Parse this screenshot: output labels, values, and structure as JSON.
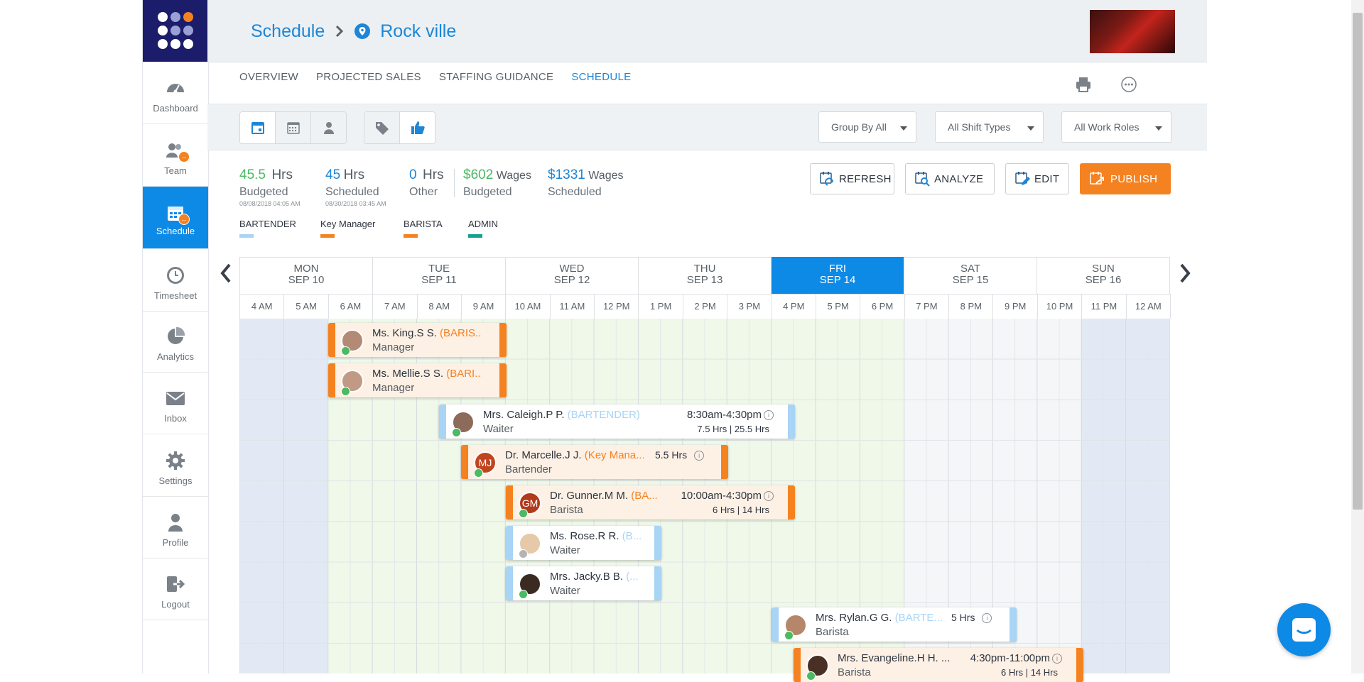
{
  "colors": {
    "brand": "#0d89e6",
    "nav_dark": "#1b1d6a",
    "orange": "#f58220",
    "green": "#4cb963",
    "bartender": "#a8d4f5",
    "admin": "#17a08f"
  },
  "sidebar": {
    "items": [
      {
        "label": "Dashboard",
        "icon": "dashboard-icon"
      },
      {
        "label": "Team",
        "icon": "team-icon",
        "badge": "..."
      },
      {
        "label": "Schedule",
        "icon": "calendar-icon",
        "badge": "...",
        "active": true
      },
      {
        "label": "Timesheet",
        "icon": "clock-icon"
      },
      {
        "label": "Analytics",
        "icon": "pie-chart-icon"
      },
      {
        "label": "Inbox",
        "icon": "mail-icon"
      },
      {
        "label": "Settings",
        "icon": "gear-icon"
      },
      {
        "label": "Profile",
        "icon": "user-icon"
      },
      {
        "label": "Logout",
        "icon": "logout-icon"
      }
    ]
  },
  "header": {
    "crumb_root": "Schedule",
    "crumb_location": "Rock ville"
  },
  "tabs": [
    {
      "label": "OVERVIEW"
    },
    {
      "label": "PROJECTED SALES"
    },
    {
      "label": "STAFFING GUIDANCE"
    },
    {
      "label": "SCHEDULE",
      "active": true
    }
  ],
  "filters": {
    "group": "Group By All",
    "shift_types": "All Shift Types",
    "work_roles": "All Work Roles"
  },
  "stats": {
    "budgeted_hrs": "45.5",
    "budgeted_unit": "Hrs",
    "budgeted_label": "Budgeted",
    "budgeted_ts": "08/08/2018 04:05 AM",
    "scheduled_hrs": "45",
    "scheduled_unit": "Hrs",
    "scheduled_label": "Scheduled",
    "scheduled_ts": "08/30/2018 03:45 AM",
    "other_hrs": "0",
    "other_unit": "Hrs",
    "other_label": "Other",
    "wages_budgeted": "$602",
    "wages_budgeted_unit": "Wages",
    "wages_budgeted_label": "Budgeted",
    "wages_scheduled": "$1331",
    "wages_scheduled_unit": "Wages",
    "wages_scheduled_label": "Scheduled"
  },
  "actions": {
    "refresh": "REFRESH",
    "analyze": "ANALYZE",
    "edit": "EDIT",
    "publish": "PUBLISH"
  },
  "legend": [
    {
      "label": "BARTENDER",
      "color": "#a8d4f5"
    },
    {
      "label": "Key Manager",
      "color": "#f58220"
    },
    {
      "label": "BARISTA",
      "color": "#f58220"
    },
    {
      "label": "ADMIN",
      "color": "#17a08f"
    }
  ],
  "days": [
    {
      "dow": "MON",
      "date": "SEP 10"
    },
    {
      "dow": "TUE",
      "date": "SEP 11"
    },
    {
      "dow": "WED",
      "date": "SEP 12"
    },
    {
      "dow": "THU",
      "date": "SEP 13"
    },
    {
      "dow": "FRI",
      "date": "SEP 14",
      "active": true
    },
    {
      "dow": "SAT",
      "date": "SEP 15"
    },
    {
      "dow": "SUN",
      "date": "SEP 16"
    }
  ],
  "hours": [
    "4 AM",
    "5 AM",
    "6 AM",
    "7 AM",
    "8 AM",
    "9 AM",
    "10 AM",
    "11 AM",
    "12 PM",
    "1 PM",
    "2 PM",
    "3 PM",
    "4 PM",
    "5 PM",
    "6 PM",
    "7 PM",
    "8 PM",
    "9 PM",
    "10 PM",
    "11 PM",
    "12 AM"
  ],
  "shifts": [
    {
      "name": "Ms. King.S S.",
      "role_tag": "(BARIS...",
      "role": "Manager",
      "type": "orange",
      "avatar": "photo",
      "status": "green"
    },
    {
      "name": "Ms. Mellie.S S.",
      "role_tag": "(BARI...",
      "role": "Manager",
      "type": "orange",
      "avatar": "photo",
      "status": "green"
    },
    {
      "name": "Mrs. Caleigh.P P.",
      "role_tag": "(BARTENDER)",
      "role": "Waiter",
      "time": "8:30am-4:30pm",
      "hrs": "7.5 Hrs | 25.5 Hrs",
      "type": "blue",
      "avatar": "photo",
      "status": "green"
    },
    {
      "name": "Dr. Marcelle.J J.",
      "role_tag": "(Key Mana...",
      "role": "Bartender",
      "time": "5.5 Hrs",
      "type": "orange",
      "avatar": "MJ",
      "status": "green"
    },
    {
      "name": "Dr. Gunner.M M.",
      "role_tag": "(BA...",
      "role": "Barista",
      "time": "10:00am-4:30pm",
      "hrs": "6 Hrs | 14 Hrs",
      "type": "orange",
      "avatar": "GM",
      "status": "green"
    },
    {
      "name": "Ms. Rose.R R.",
      "role_tag": "(B...",
      "role": "Waiter",
      "type": "blue",
      "avatar": "photo",
      "status": "gray"
    },
    {
      "name": "Mrs. Jacky.B B.",
      "role_tag": "(...",
      "role": "Waiter",
      "type": "blue",
      "avatar": "photo",
      "status": "green"
    },
    {
      "name": "Mrs. Rylan.G G.",
      "role_tag": "(BARTE...",
      "role": "Barista",
      "time": "5 Hrs",
      "type": "blue",
      "avatar": "photo",
      "status": "green"
    },
    {
      "name": "Mrs. Evangeline.H H. ...",
      "role_tag": "",
      "role": "Barista",
      "time": "4:30pm-11:00pm",
      "hrs": "6 Hrs | 14 Hrs",
      "type": "orange",
      "avatar": "photo",
      "status": "green"
    }
  ]
}
